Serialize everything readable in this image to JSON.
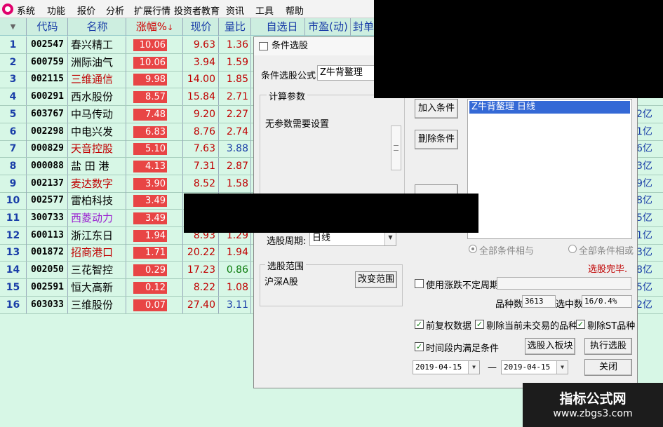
{
  "menu": [
    "系统",
    "功能",
    "报价",
    "分析",
    "扩展行情",
    "投资者教育",
    "资讯",
    "工具",
    "帮助"
  ],
  "columns": {
    "code": "代码",
    "name": "名称",
    "change": "涨幅%",
    "price": "现价",
    "volume_ratio": "量比",
    "self_select": "自选日",
    "pe": "市盈(动)",
    "seal": "封单"
  },
  "rows": [
    {
      "idx": "1",
      "code": "002547",
      "name": "春兴精工",
      "change": "10.06",
      "price": "9.63",
      "vr": "1.36",
      "tail": "",
      "name_color": "#000000",
      "vr_color": "#c00000"
    },
    {
      "idx": "2",
      "code": "600759",
      "name": "洲际油气",
      "change": "10.06",
      "price": "3.94",
      "vr": "1.59",
      "tail": "",
      "name_color": "#000000",
      "vr_color": "#c00000"
    },
    {
      "idx": "3",
      "code": "002115",
      "name": "三维通信",
      "change": "9.98",
      "price": "14.00",
      "vr": "1.85",
      "tail": "",
      "name_color": "#c00000",
      "vr_color": "#c00000"
    },
    {
      "idx": "4",
      "code": "600291",
      "name": "西水股份",
      "change": "8.57",
      "price": "15.84",
      "vr": "2.71",
      "tail": "",
      "name_color": "#000000",
      "vr_color": "#c00000"
    },
    {
      "idx": "5",
      "code": "603767",
      "name": "中马传动",
      "change": "7.48",
      "price": "9.20",
      "vr": "2.27",
      "tail": "2亿",
      "name_color": "#000000",
      "vr_color": "#c00000"
    },
    {
      "idx": "6",
      "code": "002298",
      "name": "中电兴发",
      "change": "6.83",
      "price": "8.76",
      "vr": "2.74",
      "tail": "1亿",
      "name_color": "#000000",
      "vr_color": "#c00000"
    },
    {
      "idx": "7",
      "code": "000829",
      "name": "天音控股",
      "change": "5.10",
      "price": "7.63",
      "vr": "3.88",
      "tail": "6亿",
      "name_color": "#c00000",
      "vr_color": "#1a3ea8"
    },
    {
      "idx": "8",
      "code": "000088",
      "name": "盐 田 港",
      "change": "4.13",
      "price": "7.31",
      "vr": "2.87",
      "tail": "3亿",
      "name_color": "#000000",
      "vr_color": "#c00000"
    },
    {
      "idx": "9",
      "code": "002137",
      "name": "麦达数字",
      "change": "3.90",
      "price": "8.52",
      "vr": "1.58",
      "tail": "9亿",
      "name_color": "#c00000",
      "vr_color": "#c00000"
    },
    {
      "idx": "10",
      "code": "002577",
      "name": "雷柏科技",
      "change": "3.49",
      "price": "",
      "vr": "",
      "tail": "8亿",
      "name_color": "#000000",
      "vr_color": "#c00000"
    },
    {
      "idx": "11",
      "code": "300733",
      "name": "西菱动力",
      "change": "3.49",
      "price": "",
      "vr": "",
      "tail": "5亿",
      "name_color": "#9a1fd0",
      "vr_color": "#c00000"
    },
    {
      "idx": "12",
      "code": "600113",
      "name": "浙江东日",
      "change": "1.94",
      "price": "8.93",
      "vr": "1.29",
      "tail": "1亿",
      "name_color": "#000000",
      "vr_color": "#c00000"
    },
    {
      "idx": "13",
      "code": "001872",
      "name": "招商港口",
      "change": "1.71",
      "price": "20.22",
      "vr": "1.94",
      "tail": "3亿",
      "name_color": "#c00000",
      "vr_color": "#c00000"
    },
    {
      "idx": "14",
      "code": "002050",
      "name": "三花智控",
      "change": "0.29",
      "price": "17.23",
      "vr": "0.86",
      "tail": "8亿",
      "name_color": "#000000",
      "vr_color": "#0a7a0a"
    },
    {
      "idx": "15",
      "code": "002591",
      "name": "恒大高新",
      "change": "0.12",
      "price": "8.22",
      "vr": "1.08",
      "tail": "5亿",
      "name_color": "#000000",
      "vr_color": "#c00000"
    },
    {
      "idx": "16",
      "code": "603033",
      "name": "三维股份",
      "change": "0.07",
      "price": "27.40",
      "vr": "3.11",
      "tail": "2亿",
      "name_color": "#000000",
      "vr_color": "#1a3ea8"
    }
  ],
  "dialog": {
    "title": "条件选股",
    "formula_label": "条件选股公式",
    "formula_value": "Z牛背鳌理",
    "params_group": "计算参数",
    "params_text": "无参数需要设置",
    "add_button": "加入条件",
    "delete_button": "删除条件",
    "condition_item": "Z牛背鳌理   日线",
    "period_label": "选股周期:",
    "period_value": "日线",
    "radio_all_and": "全部条件相与",
    "radio_all_or": "全部条件相或",
    "status": "选股完毕.",
    "scope_group": "选股范围",
    "scope_value": "沪深A股",
    "change_scope_button": "改变范围",
    "use_unfixed_period": "使用涨跌不定周期",
    "count_label": "品种数",
    "count_value": "3613",
    "selected_label": "选中数",
    "selected_value": "16/0.4%",
    "forward_adjust": "前复权数据",
    "exclude_not_trading": "剔除当前未交易的品种",
    "exclude_st": "剔除ST品种",
    "time_range": "时间段内满足条件",
    "to_block_button": "选股入板块",
    "execute_button": "执行选股",
    "date_from": "2019-04-15",
    "date_sep": "—",
    "date_to": "2019-04-15",
    "close_button": "关闭"
  },
  "watermark": {
    "line1": "指标公式网",
    "line2": "www.zbgs3.com"
  }
}
